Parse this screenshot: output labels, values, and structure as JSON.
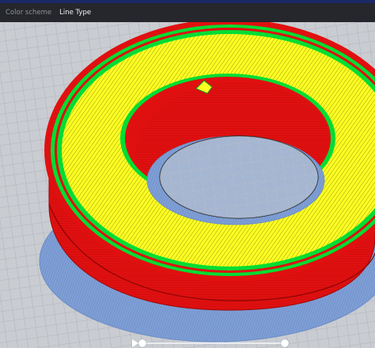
{
  "header": {
    "color_scheme_label": "Color scheme",
    "line_type_value": "Line Type"
  },
  "colors": {
    "topbar": "#25272c",
    "accent": "#1b2a66",
    "build_plate": "#c9ccd1",
    "wall_outer": "#e01010",
    "wall_inner": "#00dd33",
    "infill": "#ffff22",
    "skirt_brim": "#7f9fd6"
  },
  "scrubber": {
    "play_icon": "play-icon",
    "start_fraction": 0.0,
    "end_fraction": 1.0
  }
}
